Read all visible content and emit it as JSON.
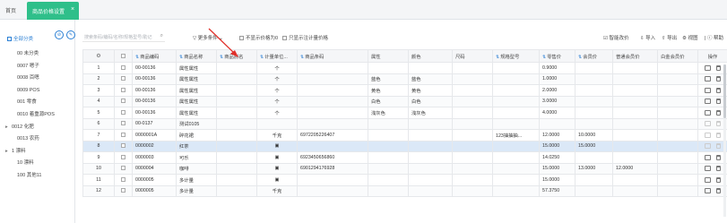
{
  "tabs": {
    "home": "首页",
    "active": "商品价格设置",
    "close": "×"
  },
  "sidebar": {
    "all": "全部分类",
    "items": [
      {
        "label": "00 未分类",
        "caret": "",
        "level": 1
      },
      {
        "label": "0007 嗯子",
        "caret": "",
        "level": 1
      },
      {
        "label": "0008 百嗯",
        "caret": "",
        "level": 1
      },
      {
        "label": "0009 POS",
        "caret": "",
        "level": 1
      },
      {
        "label": "001 零食",
        "caret": "",
        "level": 1
      },
      {
        "label": "0010 着重源POS",
        "caret": "",
        "level": 1
      },
      {
        "label": "0012 化肥",
        "caret": "▸",
        "level": 0
      },
      {
        "label": "0013 农药",
        "caret": "",
        "level": 1
      },
      {
        "label": "1 漂料",
        "caret": "▸",
        "level": 0
      },
      {
        "label": "10 漂料",
        "caret": "",
        "level": 1
      },
      {
        "label": "100 其他11",
        "caret": "",
        "level": 1
      }
    ]
  },
  "toolbar": {
    "search_placeholder": "搜索条码/编码/名称/规格型号/助记",
    "more_filters": "更多条件",
    "hide_zero": "不显示价格为0",
    "show_measure": "只显示注计量价格",
    "smart_price": "智能改价",
    "import": "导入",
    "export": "导出",
    "view": "视图",
    "help": "帮助"
  },
  "table": {
    "headers": [
      "商品编码",
      "商品名称",
      "商品别名",
      "计量单位...",
      "商品条码",
      "属性",
      "颜色",
      "尺码",
      "规格型号",
      "零售价",
      "会员价",
      "普通会员价",
      "白金会员价",
      "操作"
    ],
    "rows": [
      {
        "no": "1",
        "code": "00-00136",
        "name": "属性属性",
        "alias": "",
        "unit": "个",
        "barcode": "",
        "attr": "",
        "color": "",
        "size": "",
        "spec": "",
        "retail": "0.9000",
        "member": "",
        "normal": "",
        "platinum": ""
      },
      {
        "no": "2",
        "code": "00-00136",
        "name": "属性属性",
        "alias": "",
        "unit": "个",
        "barcode": "",
        "attr": "蓝色",
        "color": "蓝色",
        "size": "",
        "spec": "",
        "retail": "1.0000",
        "member": "",
        "normal": "",
        "platinum": ""
      },
      {
        "no": "3",
        "code": "00-00136",
        "name": "属性属性",
        "alias": "",
        "unit": "个",
        "barcode": "",
        "attr": "黄色",
        "color": "黄色",
        "size": "",
        "spec": "",
        "retail": "2.0000",
        "member": "",
        "normal": "",
        "platinum": ""
      },
      {
        "no": "4",
        "code": "00-00136",
        "name": "属性属性",
        "alias": "",
        "unit": "个",
        "barcode": "",
        "attr": "白色",
        "color": "白色",
        "size": "",
        "spec": "",
        "retail": "3.0000",
        "member": "",
        "normal": "",
        "platinum": ""
      },
      {
        "no": "5",
        "code": "00-00136",
        "name": "属性属性",
        "alias": "",
        "unit": "个",
        "barcode": "",
        "attr": "浅灰色",
        "color": "浅灰色",
        "size": "",
        "spec": "",
        "retail": "4.0000",
        "member": "",
        "normal": "",
        "platinum": ""
      },
      {
        "no": "6",
        "code": "00-0137",
        "name": "测试0105",
        "alias": "",
        "unit": "",
        "barcode": "",
        "attr": "",
        "color": "",
        "size": "",
        "spec": "",
        "retail": "",
        "member": "",
        "normal": "",
        "platinum": ""
      },
      {
        "no": "7",
        "code": "0000001A",
        "name": "碎花裙",
        "alias": "",
        "unit": "千克",
        "barcode": "6972205226407",
        "attr": "",
        "color": "",
        "size": "",
        "spec": "123抽抽抽...",
        "retail": "12.0000",
        "member": "10.0000",
        "normal": "",
        "platinum": ""
      },
      {
        "no": "8",
        "code": "0000002",
        "name": "红茶",
        "alias": "",
        "unit": "▣",
        "barcode": "",
        "attr": "",
        "color": "",
        "size": "",
        "spec": "",
        "retail": "15.0000",
        "member": "15.0000",
        "normal": "",
        "platinum": ""
      },
      {
        "no": "9",
        "code": "0000003",
        "name": "可乐",
        "alias": "",
        "unit": "▣",
        "barcode": "6923450656860",
        "attr": "",
        "color": "",
        "size": "",
        "spec": "",
        "retail": "14.0250",
        "member": "",
        "normal": "",
        "platinum": ""
      },
      {
        "no": "10",
        "code": "0000004",
        "name": "咖啡",
        "alias": "",
        "unit": "▣",
        "barcode": "6901294176928",
        "attr": "",
        "color": "",
        "size": "",
        "spec": "",
        "retail": "15.0000",
        "member": "13.0000",
        "normal": "12.0000",
        "platinum": ""
      },
      {
        "no": "11",
        "code": "0000005",
        "name": "多计量",
        "alias": "",
        "unit": "▣",
        "barcode": "",
        "attr": "",
        "color": "",
        "size": "",
        "spec": "",
        "retail": "15.0000",
        "member": "",
        "normal": "",
        "platinum": ""
      },
      {
        "no": "12",
        "code": "0000005",
        "name": "多计量",
        "alias": "",
        "unit": "千克",
        "barcode": "",
        "attr": "",
        "color": "",
        "size": "",
        "spec": "",
        "retail": "57.3750",
        "member": "",
        "normal": "",
        "platinum": ""
      }
    ],
    "selected_row": 8
  },
  "colors": {
    "accent": "#2fbf8a",
    "link": "#2a7fd4",
    "annotation_arrow": "#e0302a"
  }
}
